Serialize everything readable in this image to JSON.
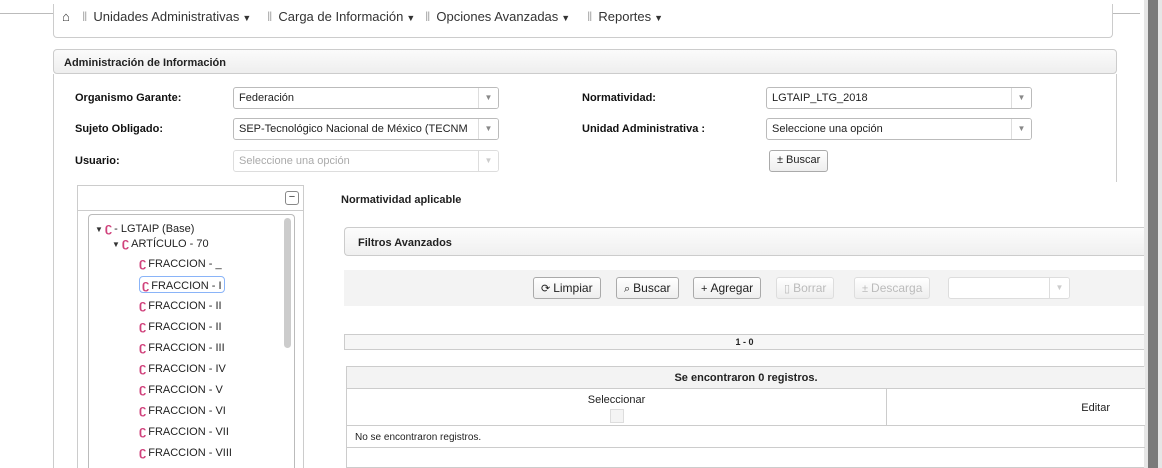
{
  "nav": {
    "home_icon": "home-icon",
    "items": [
      {
        "label": "Unidades Administrativas"
      },
      {
        "label": "Carga de Información"
      },
      {
        "label": "Opciones Avanzadas"
      },
      {
        "label": "Reportes"
      }
    ]
  },
  "panel": {
    "title": "Administración de Información"
  },
  "form": {
    "organismo_label": "Organismo Garante:",
    "organismo_value": "Federación",
    "normatividad_label": "Normatividad:",
    "normatividad_value": "LGTAIP_LTG_2018",
    "sujeto_label": "Sujeto Obligado:",
    "sujeto_value": "SEP-Tecnológico Nacional de México (TECNM",
    "unidad_label": "Unidad Administrativa :",
    "unidad_value": "Seleccione una opción",
    "usuario_label": "Usuario:",
    "usuario_value": "Seleccione una opción",
    "buscar_label": "Buscar",
    "buscar_icon": "±"
  },
  "tree": {
    "collapse_symbol": "−",
    "root_label": "- LGTAIP (Base)",
    "article_label": "ARTÍCULO - 70",
    "fractions": [
      "FRACCION - _",
      "FRACCION - I",
      "FRACCION - II",
      "FRACCION - II",
      "FRACCION - III",
      "FRACCION - IV",
      "FRACCION - V",
      "FRACCION - VI",
      "FRACCION - VII",
      "FRACCION - VIII"
    ],
    "selected_index": 1
  },
  "main": {
    "normatividad_title": "Normatividad aplicable",
    "filtros_title": "Filtros Avanzados",
    "toolbar": {
      "limpiar": "Limpiar",
      "buscar": "Buscar",
      "agregar": "Agregar",
      "borrar": "Borrar",
      "descarga": "Descarga"
    },
    "pager_text": "1 - 0",
    "grid": {
      "caption": "Se encontraron 0 registros.",
      "col_seleccionar": "Seleccionar",
      "col_editar": "Editar",
      "empty_text": "No se encontraron registros."
    }
  },
  "colors": {
    "tree_icon": "#d0417b",
    "border": "#cccccc",
    "scrollbar": "#7a7a7a"
  }
}
